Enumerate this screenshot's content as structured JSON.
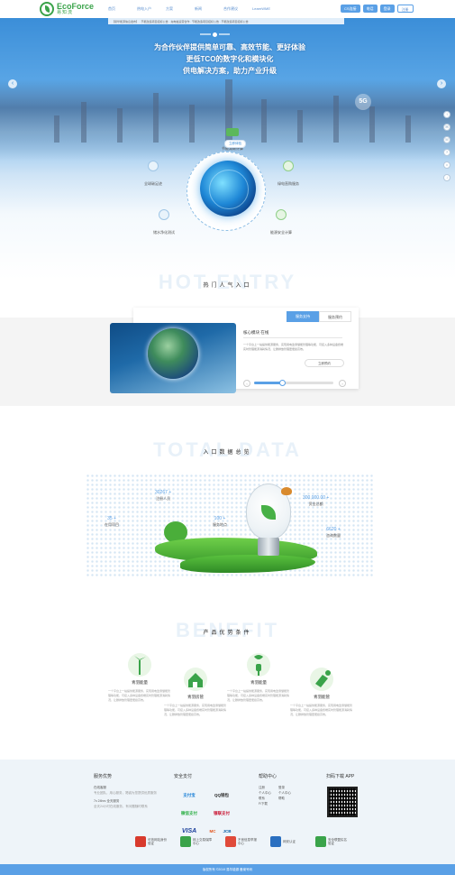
{
  "header": {
    "logo_en": "EcoForce",
    "logo_cn": "易知流",
    "nav": [
      "首页",
      "热电入户",
      "方案",
      "新闻",
      "合作建议",
      "LearnWME"
    ],
    "buttons": [
      "CS连接",
      "电话",
      "登录",
      "注册"
    ]
  },
  "hero": {
    "ticker": "【易华能源信息发布】 · 节能改造项目招标公告 · 充电桩运营合作 · 节能改造项目招标公告 · 节能改造项目招标公告",
    "slogan_lines": [
      "为合作伙伴提供简单可靠、高效节能、更好体验",
      "更低TCO的数字化和模块化",
      "供电解决方案，助力产业升级"
    ],
    "badge": "5G",
    "calc_title": "节能减碳计算",
    "calc_button": "立即体验",
    "features": [
      {
        "label": "全球碳足迹",
        "icon": "search-icon"
      },
      {
        "label": "绿电直购服务",
        "icon": "plant-icon"
      },
      {
        "label": "储水净化测试",
        "icon": "cloud-icon"
      },
      {
        "label": "能源安全计算",
        "icon": "shield-icon"
      }
    ],
    "sidebar": [
      "↑",
      "✉",
      "☏",
      "?",
      "⌂",
      "↓"
    ]
  },
  "hot": {
    "bg_title": "HOT ENTRY",
    "title": "热门人气入口",
    "tabs": [
      "服务支持",
      "服务预约"
    ],
    "card_title": "核心模块 在线",
    "card_text": "一个平台上一站提供能源服务，实现用电监测储能管理等功能，可接入多种设备终端实时管理能源消耗情况，让碳排放管理更便捷高效。",
    "more": "立即预约"
  },
  "total": {
    "bg_title": "TOTAL DATA",
    "title": "入口数据总览",
    "stats": [
      {
        "value": "30267 +",
        "label": "注册人员"
      },
      {
        "value": "35 +",
        "label": "在用项目"
      },
      {
        "value": "100 +",
        "label": "服务地点"
      },
      {
        "value": "300,000.00 +",
        "label": "资金总额"
      },
      {
        "value": "6620 +",
        "label": "咨询数量"
      }
    ]
  },
  "benefit": {
    "bg_title": "BENEFIT",
    "title": "产品优势条件",
    "items": [
      {
        "title": "青羽能量",
        "desc": "一个平台上一站提供能源服务，实现用电监测储能管理等功能，可接入多种设备终端实时管理能源消耗情况，让碳排放管理更便捷高效。",
        "color": "#3aa34a"
      },
      {
        "title": "青羽房管",
        "desc": "一个平台上一站提供能源服务，实现用电监测储能管理等功能，可接入多种设备终端实时管理能源消耗情况，让碳排放管理更便捷高效。",
        "color": "#3aa34a"
      },
      {
        "title": "青羽能量",
        "desc": "一个平台上一站提供能源服务，实现用电监测储能管理等功能，可接入多种设备终端实时管理能源消耗情况，让碳排放管理更便捷高效。",
        "color": "#3aa34a"
      },
      {
        "title": "青羽能管",
        "desc": "一个平台上一站提供能源服务，实现用电监测储能管理等功能，可接入多种设备终端实时管理能源消耗情况，让碳排放管理更便捷高效。",
        "color": "#3aa34a"
      }
    ]
  },
  "footer": {
    "col1": {
      "title": "服务优势",
      "items": [
        "在线客服",
        "专业团队，用心服务，竭诚为您提供优质服务",
        "7x 24hrs 全天服务",
        "全天24小时在线服务，有问题随时联系"
      ]
    },
    "col2": {
      "title": "安全支付",
      "payments": [
        "支付宝",
        "QQ钱包",
        "微信支付",
        "银联支付",
        "VISA",
        "MC",
        "JCB"
      ]
    },
    "col3": {
      "title": "帮助中心",
      "items": [
        "注册",
        "登录",
        "个人中心",
        "个人中心",
        "联系",
        "帮助",
        "Fi下载"
      ]
    },
    "col4": {
      "title": "扫码下载 APP"
    },
    "certs": [
      "可信网站身份验证",
      "网上交易保障中心",
      "不良信息举报中心",
      "网安认证",
      "安全联盟实名验证"
    ],
    "copyright": "版权所有 ©2019 易华能源 备案号码"
  },
  "colors": {
    "accent": "#5aa0e6",
    "brand": "#3aa34a"
  }
}
